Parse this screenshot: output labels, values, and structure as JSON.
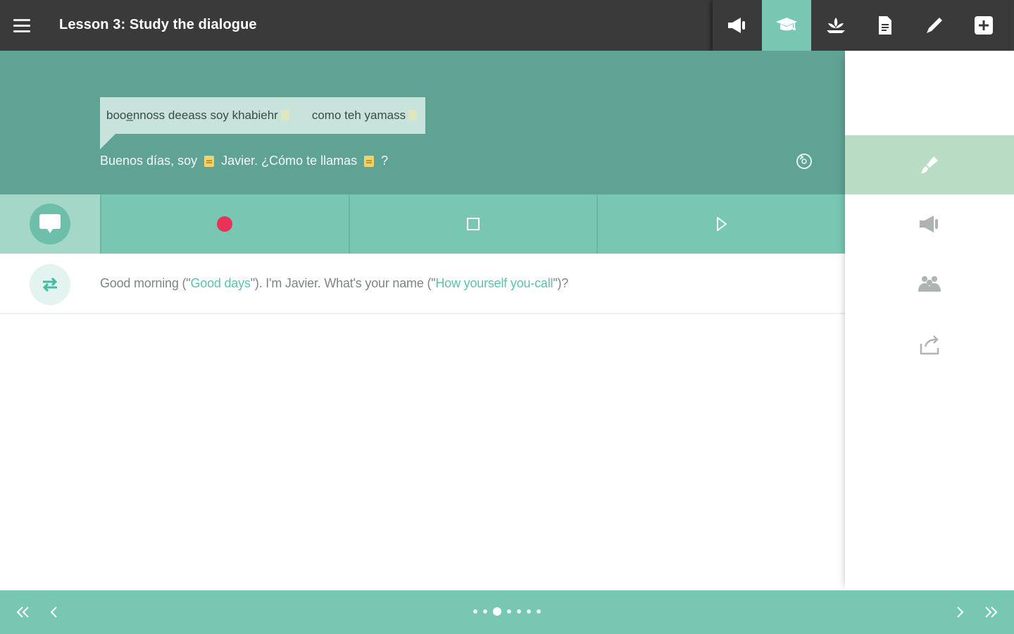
{
  "header": {
    "title": "Lesson 3: Study the dialogue",
    "tools": [
      {
        "icon": "megaphone-icon",
        "active": false
      },
      {
        "icon": "graduation-cap-icon",
        "active": true
      },
      {
        "icon": "lotus-icon",
        "active": false
      },
      {
        "icon": "document-icon",
        "active": false
      },
      {
        "icon": "pencil-icon",
        "active": false
      },
      {
        "icon": "plus-square-icon",
        "active": false
      }
    ]
  },
  "dialogue": {
    "pronunciation": {
      "part1": "booe̲nnoss deeass soy khabiehr",
      "part2": "como teh yamass"
    },
    "sentence": {
      "part1": "Buenos días, soy",
      "part2": "Javier. ¿Cómo te llamas",
      "part3": "?"
    }
  },
  "translation": {
    "t1": "Good morning (\"",
    "lit1": "Good days",
    "t2": "\"). I'm Javier. What's your name (\"",
    "lit2": "How yourself you-call",
    "t3": "\")?"
  },
  "sidebar": {
    "items": [
      {
        "icon": "brush-icon",
        "active": true
      },
      {
        "icon": "speaker-icon",
        "active": false
      },
      {
        "icon": "people-icon",
        "active": false
      },
      {
        "icon": "share-icon",
        "active": false
      }
    ]
  },
  "pager": {
    "current_page": 3,
    "total_pages": 7
  },
  "colors": {
    "topbar": "#3a3a3a",
    "accent": "#77c7b2",
    "panel": "#5fa394",
    "record": "#e8325a",
    "highlight": "#59c3b0"
  }
}
